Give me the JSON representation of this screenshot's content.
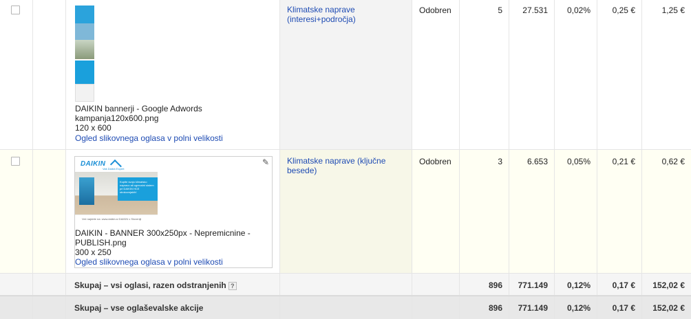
{
  "rows": [
    {
      "ad": {
        "title": "DAIKIN bannerji - Google Adwords kampanja120x600.png",
        "size": "120 x 600",
        "link": "Ogled slikovnega oglasa v polni velikosti"
      },
      "ad_group": "Klimatske naprave (interesi+področja)",
      "status": "Odobren",
      "clicks": "5",
      "impressions": "27.531",
      "ctr": "0,02%",
      "avg_cpc": "0,25 €",
      "cost": "1,25 €"
    },
    {
      "ad": {
        "title": "DAIKIN - BANNER 300x250px - Nepremicnine - PUBLISH.png",
        "size": "300 x 250",
        "link": "Ogled slikovnega oglasa v polni velikosti",
        "banner_logo": "DAIKIN",
        "banner_logo_sub": "Vaš Daikin Expert",
        "banner_panel": "Kupite svojo klimatsko napravo ali ogrevalni sistem pri DAIKIN HCE strokovnjakih!",
        "banner_footer": "Več najdete na: www.daikin.si   DAIKIN v Sloveniji"
      },
      "ad_group": "Klimatske naprave (ključne besede)",
      "status": "Odobren",
      "clicks": "3",
      "impressions": "6.653",
      "ctr": "0,05%",
      "avg_cpc": "0,21 €",
      "cost": "0,62 €"
    }
  ],
  "totals": [
    {
      "label": "Skupaj – vsi oglasi, razen odstranjenih",
      "help": "?",
      "clicks": "896",
      "impressions": "771.149",
      "ctr": "0,12%",
      "avg_cpc": "0,17 €",
      "cost": "152,02 €"
    },
    {
      "label": "Skupaj – vse oglaševalske akcije",
      "clicks": "896",
      "impressions": "771.149",
      "ctr": "0,12%",
      "avg_cpc": "0,17 €",
      "cost": "152,02 €"
    }
  ],
  "colors": {
    "link": "#1e4bb3",
    "status_enabled": "#35a935",
    "row_highlight": "#fffff3"
  },
  "icons": [
    "status-dot-icon",
    "dropdown-caret-icon",
    "pencil-icon",
    "help-icon"
  ]
}
